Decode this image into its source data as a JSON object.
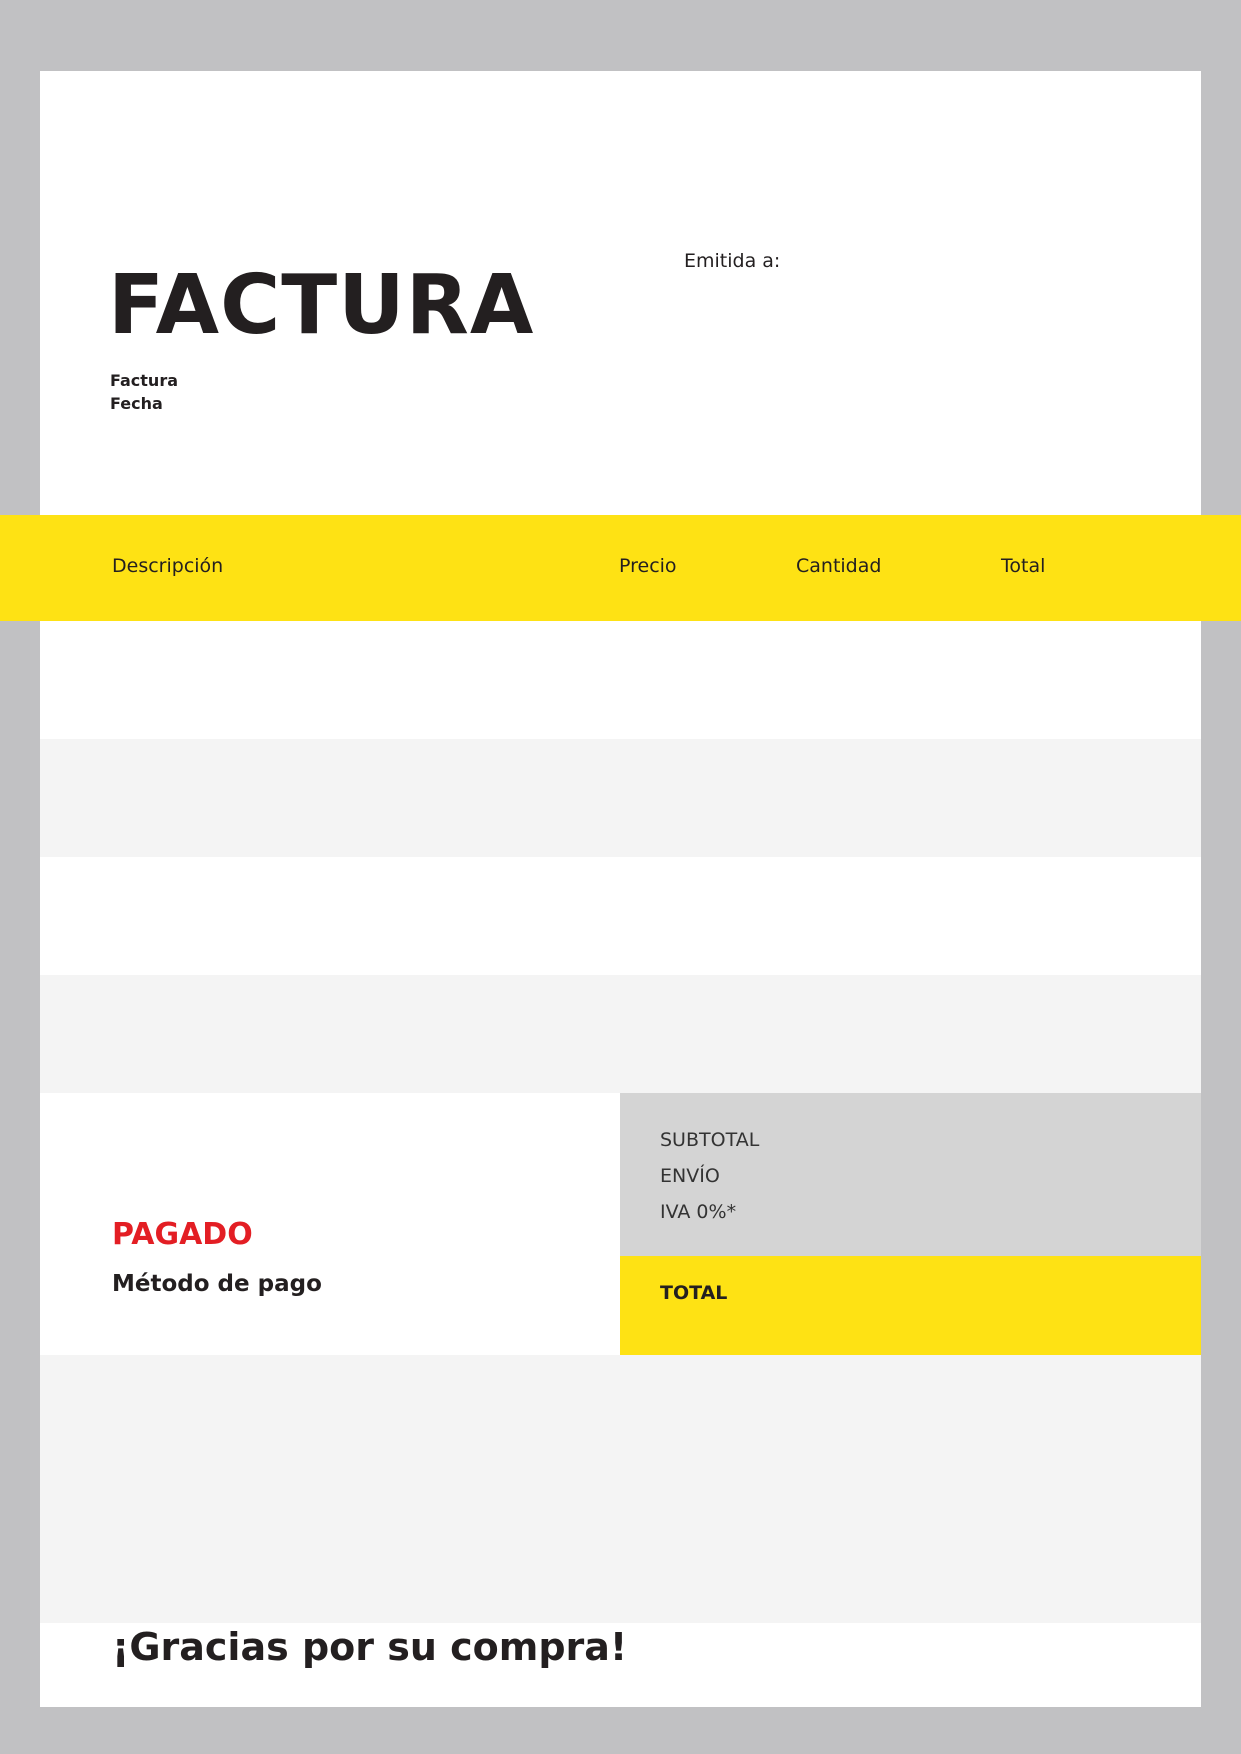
{
  "document": {
    "title": "FACTURA",
    "invoice_label": "Factura",
    "date_label": "Fecha",
    "issued_to_label": "Emitida a:"
  },
  "table": {
    "headers": [
      "Descripción",
      "Precio",
      "Cantidad",
      "Total"
    ],
    "rows": []
  },
  "totals": {
    "subtotal_label": "SUBTOTAL",
    "shipping_label": "ENVÍO",
    "tax_label": "IVA 0%*",
    "total_label": "TOTAL"
  },
  "payment": {
    "status": "PAGADO",
    "method_label": "Método de pago"
  },
  "footer": {
    "thanks": "¡Gracias por su compra!"
  },
  "colors": {
    "accent_yellow": "#fee214",
    "paid_red": "#e31e24",
    "totals_gray": "#d4d4d4",
    "row_alt_gray": "#f4f4f4",
    "background_gray": "#c1c1c3"
  }
}
